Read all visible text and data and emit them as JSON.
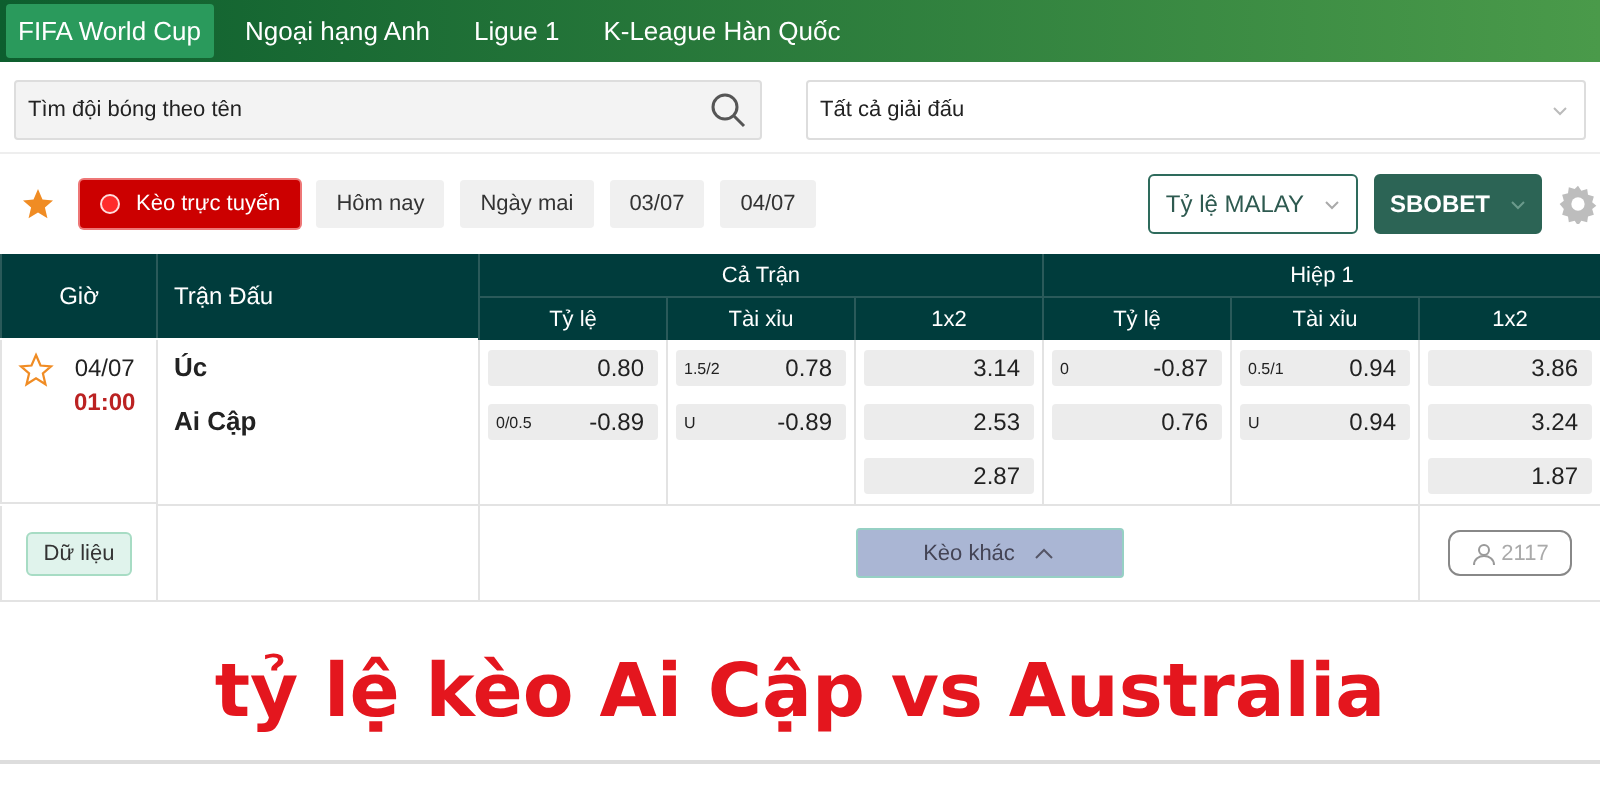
{
  "tabs": [
    {
      "label": "FIFA World Cup",
      "selected": true
    },
    {
      "label": "Ngoại hạng Anh",
      "selected": false
    },
    {
      "label": "Ligue 1",
      "selected": false
    },
    {
      "label": "K-League Hàn Quốc",
      "selected": false
    }
  ],
  "search": {
    "placeholder": "Tìm đội bóng theo tên"
  },
  "league_select": {
    "value": "Tất cả giải đấu"
  },
  "filters": [
    {
      "label": "Kèo trực tuyến",
      "selected": true
    },
    {
      "label": "Hôm nay",
      "selected": false
    },
    {
      "label": "Ngày mai",
      "selected": false
    },
    {
      "label": "03/07",
      "selected": false
    },
    {
      "label": "04/07",
      "selected": false
    }
  ],
  "selects": [
    {
      "label": "Tỷ lệ MALAY",
      "kind": "outline"
    },
    {
      "label": "SBOBET",
      "kind": "filled"
    }
  ],
  "table": {
    "time_header": "Giờ",
    "match_header": "Trận Đấu",
    "groups": [
      {
        "title": "Cả Trận",
        "columns": [
          "Tỷ lệ",
          "Tài xỉu",
          "1x2"
        ]
      },
      {
        "title": "Hiệp 1",
        "columns": [
          "Tỷ lệ",
          "Tài xỉu",
          "1x2"
        ]
      }
    ],
    "match": {
      "favorite": false,
      "date": "04/07",
      "time": "01:00",
      "home": "Úc",
      "away": "Ai Cập",
      "markets": [
        [
          {
            "value": "0.80"
          },
          {
            "label": "0/0.5",
            "value": "-0.89"
          }
        ],
        [
          {
            "label": "1.5/2",
            "value": "0.78"
          },
          {
            "label": "U",
            "value": "-0.89"
          }
        ],
        [
          {
            "value": "3.14"
          },
          {
            "value": "2.53"
          },
          {
            "value": "2.87"
          }
        ],
        [
          {
            "label": "0",
            "value": "-0.87"
          },
          {
            "value": "0.76"
          }
        ],
        [
          {
            "label": "0.5/1",
            "value": "0.94"
          },
          {
            "label": "U",
            "value": "0.94"
          }
        ],
        [
          {
            "value": "3.86"
          },
          {
            "value": "3.24"
          },
          {
            "value": "1.87"
          }
        ]
      ]
    },
    "data_button": "Dữ liệu",
    "more_button": "Kèo khác",
    "viewers": "2117"
  },
  "caption": "tỷ lệ kèo Ai Cập vs Australia"
}
